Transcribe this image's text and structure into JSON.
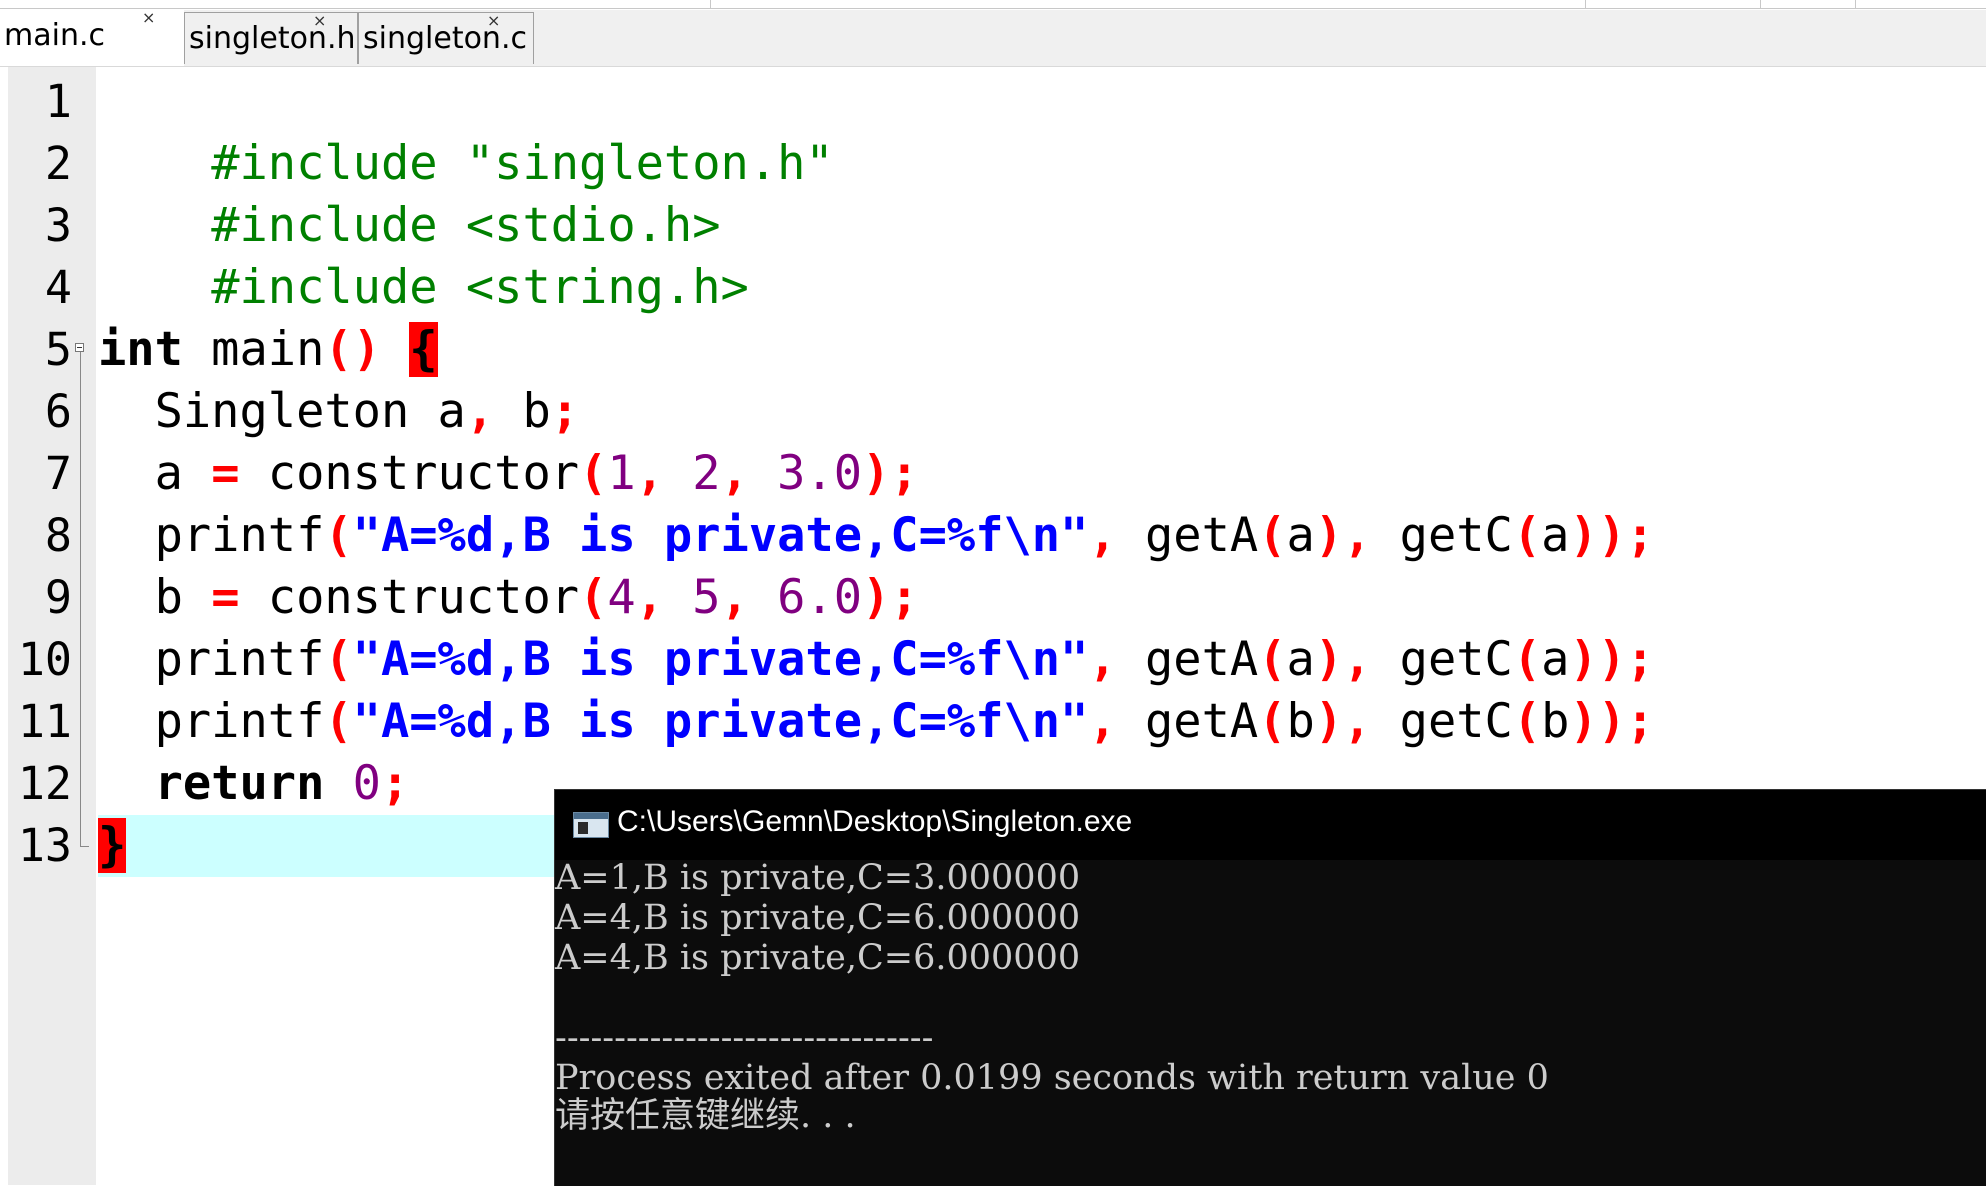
{
  "tabs": [
    {
      "label": "main.c",
      "active": true
    },
    {
      "label": "singleton.h",
      "active": false
    },
    {
      "label": "singleton.c",
      "active": false
    }
  ],
  "tab_close_glyph": "×",
  "line_numbers": [
    "1",
    "2",
    "3",
    "4",
    "5",
    "6",
    "7",
    "8",
    "9",
    "10",
    "11",
    "12",
    "13"
  ],
  "code": {
    "l1": {
      "directive": "#include \"singleton.h\""
    },
    "l2": {
      "directive": "#include <stdio.h>"
    },
    "l3": {
      "directive": "#include <string.h>"
    },
    "l5": {
      "kw": "int",
      "name": " main",
      "parens": "()",
      "space": " ",
      "brace": "{"
    },
    "l6": {
      "indent": "  ",
      "text": "Singleton a",
      "comma": ",",
      "text2": " b",
      "semi": ";"
    },
    "l7": {
      "indent": "  ",
      "var": "a ",
      "eq": "=",
      "fn": " constructor",
      "open": "(",
      "n1": "1",
      "c1": ",",
      "n2": " 2",
      "c2": ",",
      "n3": " 3.0",
      "close": ");"
    },
    "l8": {
      "indent": "  ",
      "fn": "printf",
      "open": "(",
      "str": "\"A=%d,B is private,C=%f\\n\"",
      "c1": ",",
      "a1": " getA",
      "o1": "(",
      "v1": "a",
      "cl1": ")",
      "c2": ",",
      "a2": " getC",
      "o2": "(",
      "v2": "a",
      "cl2": "));"
    },
    "l9": {
      "indent": "  ",
      "var": "b ",
      "eq": "=",
      "fn": " constructor",
      "open": "(",
      "n1": "4",
      "c1": ",",
      "n2": " 5",
      "c2": ",",
      "n3": " 6.0",
      "close": ");"
    },
    "l10": {
      "indent": "  ",
      "fn": "printf",
      "open": "(",
      "str": "\"A=%d,B is private,C=%f\\n\"",
      "c1": ",",
      "a1": " getA",
      "o1": "(",
      "v1": "a",
      "cl1": ")",
      "c2": ",",
      "a2": " getC",
      "o2": "(",
      "v2": "a",
      "cl2": "));"
    },
    "l11": {
      "indent": "  ",
      "fn": "printf",
      "open": "(",
      "str": "\"A=%d,B is private,C=%f\\n\"",
      "c1": ",",
      "a1": " getA",
      "o1": "(",
      "v1": "b",
      "cl1": ")",
      "c2": ",",
      "a2": " getC",
      "o2": "(",
      "v2": "b",
      "cl2": "));"
    },
    "l12": {
      "indent": "  ",
      "kw": "return",
      "space": " ",
      "num": "0",
      "semi": ";"
    },
    "l13": {
      "brace": "}"
    }
  },
  "console": {
    "title": "C:\\Users\\Gemn\\Desktop\\Singleton.exe",
    "lines": [
      "A=1,B is private,C=3.000000",
      "A=4,B is private,C=6.000000",
      "A=4,B is private,C=6.000000",
      "",
      "--------------------------------",
      "Process exited after 0.0199 seconds with return value 0",
      "请按任意键继续. . ."
    ]
  },
  "colors": {
    "preprocessor": "#008000",
    "operator": "#ff0000",
    "number": "#800080",
    "string": "#0000ff",
    "brace_match_bg": "#ff0000",
    "current_line_bg": "#ccffff"
  }
}
